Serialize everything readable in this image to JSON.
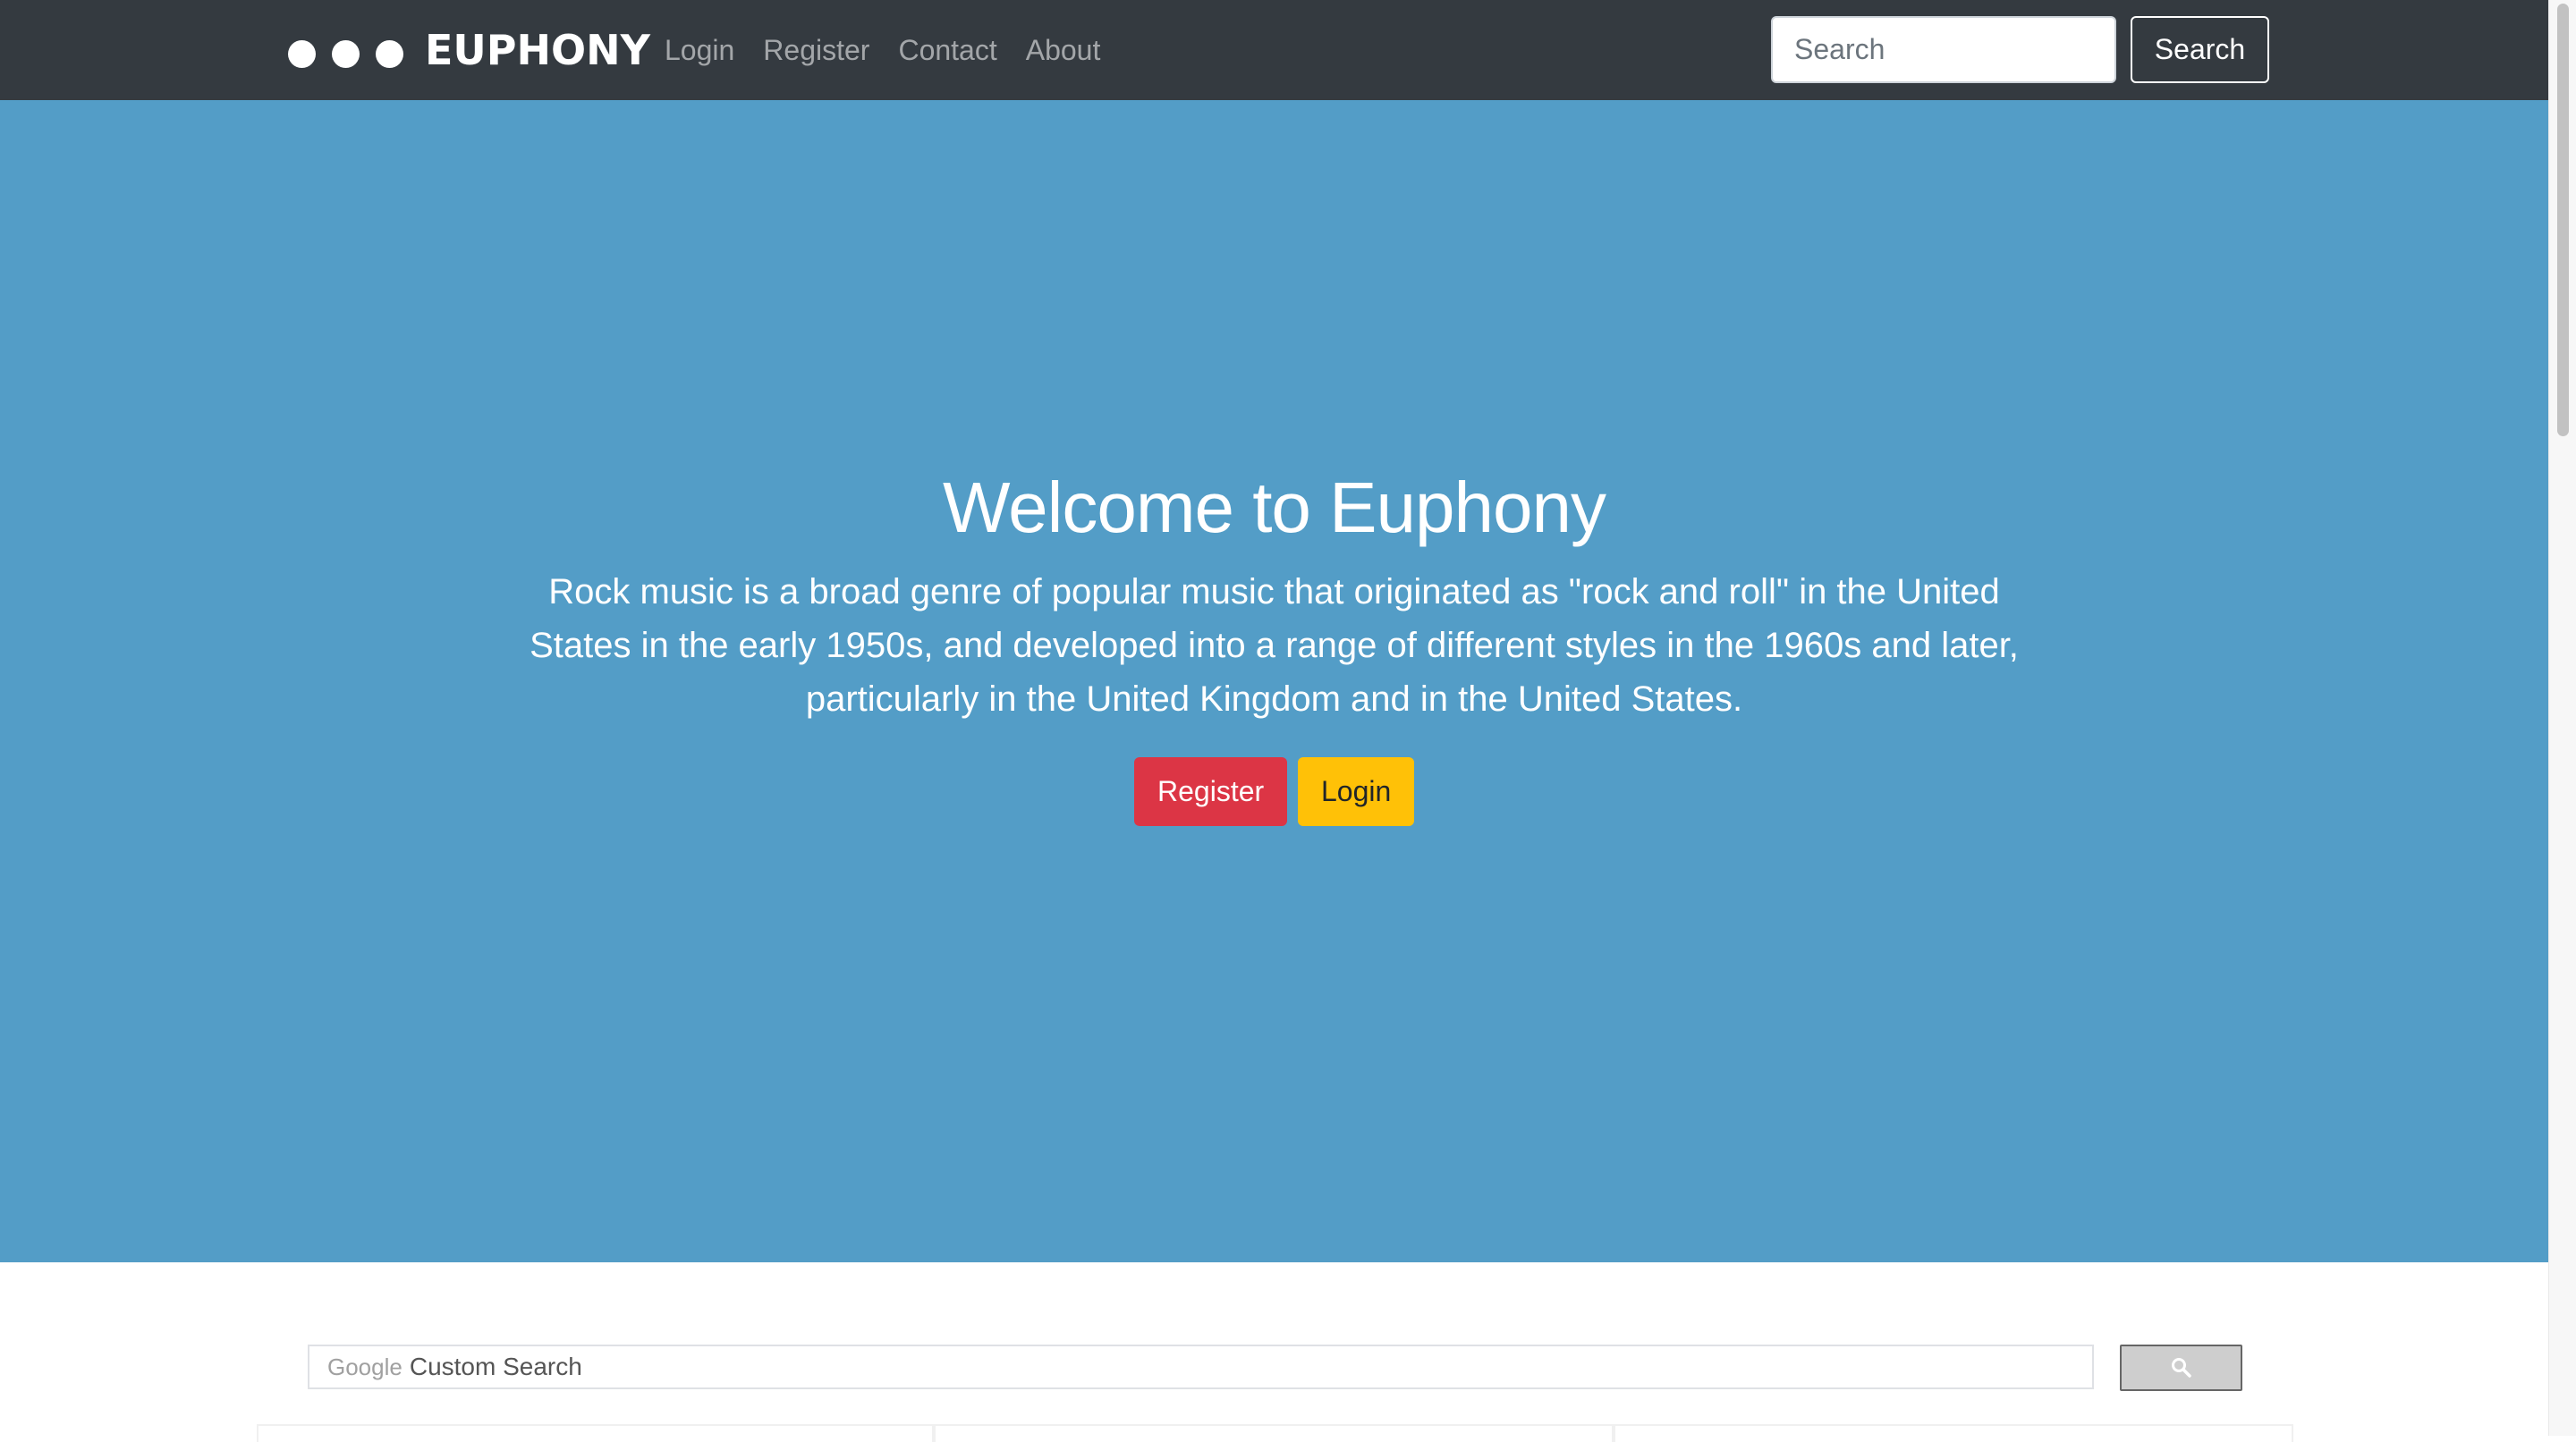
{
  "navbar": {
    "brand": "EUPHONY",
    "links": [
      {
        "label": "Login"
      },
      {
        "label": "Register"
      },
      {
        "label": "Contact"
      },
      {
        "label": "About"
      }
    ],
    "search_placeholder": "Search",
    "search_button": "Search"
  },
  "hero": {
    "title": "Welcome to Euphony",
    "text": "Rock music is a broad genre of popular music that originated as \"rock and roll\" in the United States in the early 1950s, and developed into a range of different styles in the 1960s and later, particularly in the United Kingdom and in the United States.",
    "register_button": "Register",
    "login_button": "Login"
  },
  "custom_search": {
    "brand": "Google",
    "placeholder": "Custom Search",
    "button_icon": "search-icon"
  },
  "colors": {
    "navbar_bg": "#343a40",
    "hero_bg": "#539dc7",
    "register_btn": "#dc3545",
    "login_btn": "#ffc107"
  }
}
